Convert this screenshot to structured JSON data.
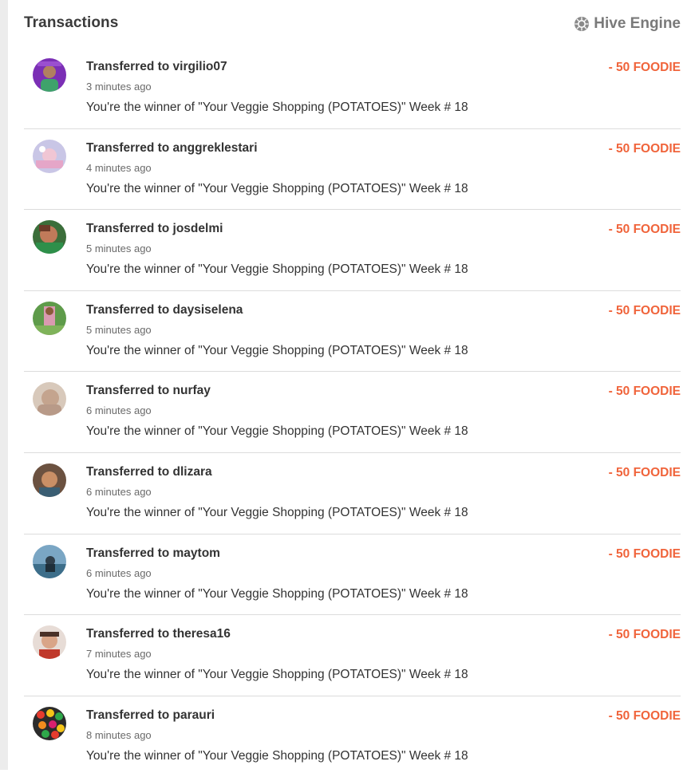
{
  "header": {
    "title": "Transactions",
    "engine_label": "Hive Engine",
    "engine_icon": "hive-engine-icon"
  },
  "colors": {
    "amount": "#f0643b",
    "title": "#333333",
    "muted": "#6a6a6a",
    "divider": "#dcdcdc"
  },
  "transactions": [
    {
      "title": "Transferred to virgilio07",
      "time": "3 minutes ago",
      "memo": "You're the winner of \"Your Veggie Shopping (POTATOES)\" Week # 18",
      "amount": "- 50 FOODIE",
      "avatar_icon": "avatar-virgilio07"
    },
    {
      "title": "Transferred to anggreklestari",
      "time": "4 minutes ago",
      "memo": "You're the winner of \"Your Veggie Shopping (POTATOES)\" Week # 18",
      "amount": "- 50 FOODIE",
      "avatar_icon": "avatar-anggreklestari"
    },
    {
      "title": "Transferred to josdelmi",
      "time": "5 minutes ago",
      "memo": "You're the winner of \"Your Veggie Shopping (POTATOES)\" Week # 18",
      "amount": "- 50 FOODIE",
      "avatar_icon": "avatar-josdelmi"
    },
    {
      "title": "Transferred to daysiselena",
      "time": "5 minutes ago",
      "memo": "You're the winner of \"Your Veggie Shopping (POTATOES)\" Week # 18",
      "amount": "- 50 FOODIE",
      "avatar_icon": "avatar-daysiselena"
    },
    {
      "title": "Transferred to nurfay",
      "time": "6 minutes ago",
      "memo": "You're the winner of \"Your Veggie Shopping (POTATOES)\" Week # 18",
      "amount": "- 50 FOODIE",
      "avatar_icon": "avatar-nurfay"
    },
    {
      "title": "Transferred to dlizara",
      "time": "6 minutes ago",
      "memo": "You're the winner of \"Your Veggie Shopping (POTATOES)\" Week # 18",
      "amount": "- 50 FOODIE",
      "avatar_icon": "avatar-dlizara"
    },
    {
      "title": "Transferred to maytom",
      "time": "6 minutes ago",
      "memo": "You're the winner of \"Your Veggie Shopping (POTATOES)\" Week # 18",
      "amount": "- 50 FOODIE",
      "avatar_icon": "avatar-maytom"
    },
    {
      "title": "Transferred to theresa16",
      "time": "7 minutes ago",
      "memo": "You're the winner of \"Your Veggie Shopping (POTATOES)\" Week # 18",
      "amount": "- 50 FOODIE",
      "avatar_icon": "avatar-theresa16"
    },
    {
      "title": "Transferred to parauri",
      "time": "8 minutes ago",
      "memo": "You're the winner of \"Your Veggie Shopping (POTATOES)\" Week # 18",
      "amount": "- 50 FOODIE",
      "avatar_icon": "avatar-parauri"
    }
  ]
}
